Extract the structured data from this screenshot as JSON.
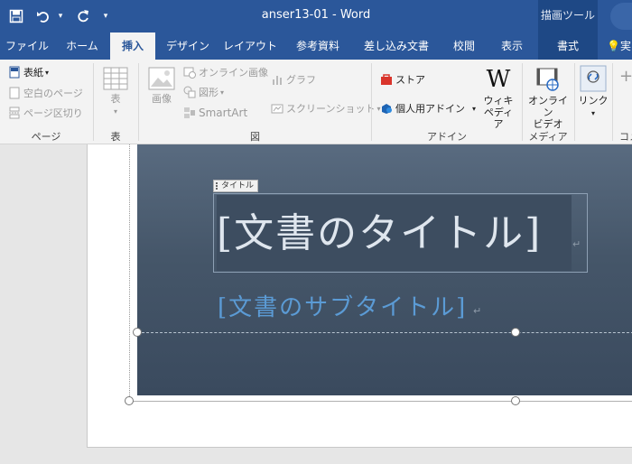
{
  "titlebar": {
    "doc_title": "anser13-01  -  Word",
    "context_title": "描画ツール"
  },
  "qat": {
    "save_icon": "save-icon",
    "undo_icon": "undo-icon",
    "redo_icon": "redo-icon"
  },
  "tabs": [
    {
      "label": "ファイル"
    },
    {
      "label": "ホーム"
    },
    {
      "label": "挿入"
    },
    {
      "label": "デザイン"
    },
    {
      "label": "レイアウト"
    },
    {
      "label": "参考資料"
    },
    {
      "label": "差し込み文書"
    },
    {
      "label": "校閲"
    },
    {
      "label": "表示"
    },
    {
      "label": "書式"
    },
    {
      "label": "実"
    }
  ],
  "ribbon": {
    "pages": {
      "cover": "表紙",
      "blank": "空白のページ",
      "break": "ページ区切り",
      "label": "ページ"
    },
    "table": {
      "button": "表",
      "label": "表"
    },
    "illust": {
      "picture": "画像",
      "online_picture": "オンライン画像",
      "shapes": "図形",
      "smartart": "SmartArt",
      "chart": "グラフ",
      "screenshot": "スクリーンショット",
      "label": "図"
    },
    "addins": {
      "store": "ストア",
      "my_addins": "個人用アドイン",
      "wiki_line1": "ウィキ",
      "wiki_line2": "ペディア",
      "wiki_glyph": "W",
      "label": "アドイン"
    },
    "media": {
      "line1": "オンライン",
      "line2": "ビデオ",
      "label": "メディア"
    },
    "links": {
      "button": "リンク"
    },
    "comments": {
      "label": "コメ"
    }
  },
  "document": {
    "cc_tag": "タイトル",
    "title": "[文書のタイトル]",
    "subtitle": "[文書のサブタイトル]",
    "para_mark": "↵"
  },
  "colors": {
    "titlebar": "#2b579a",
    "context": "#1e4885",
    "subtitle": "#5b9bd5",
    "cover_top": "#596b80",
    "cover_bottom": "#3a4a5e"
  }
}
